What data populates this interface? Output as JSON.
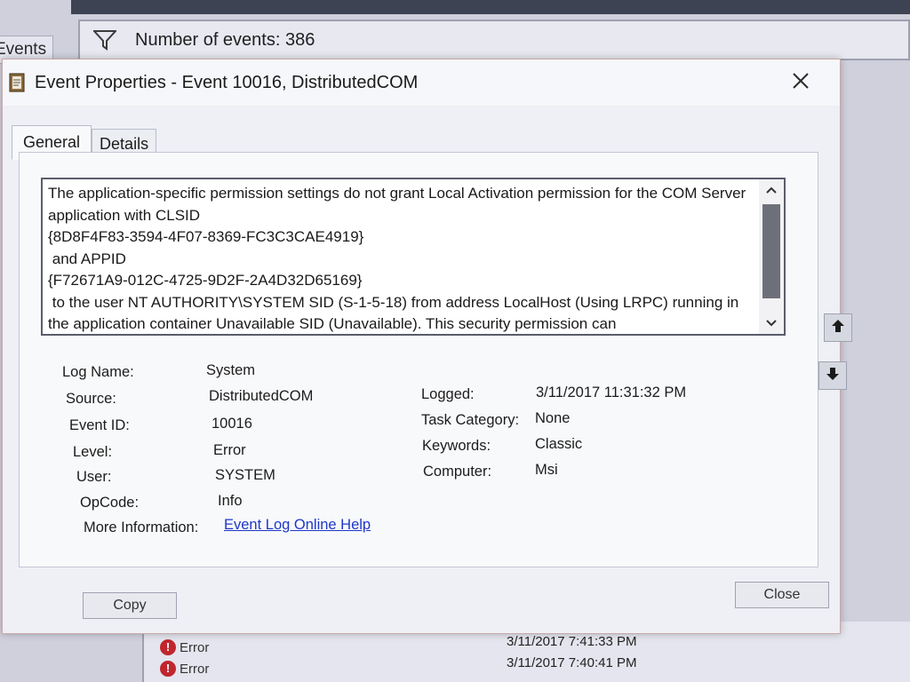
{
  "background": {
    "tab_label": "Events",
    "filter_text": "Number of events: 386",
    "rows": [
      {
        "level": "Error",
        "time": "3/11/2017 7:41:33 PM"
      },
      {
        "level": "Error",
        "time": "3/11/2017 7:40:41 PM"
      }
    ]
  },
  "dialog": {
    "title": "Event Properties - Event 10016, DistributedCOM",
    "tabs": [
      "General",
      "Details"
    ],
    "description": "The application-specific permission settings do not grant Local Activation permission for the COM Server application with CLSID\n{8D8F4F83-3594-4F07-8369-FC3C3CAE4919}\n and APPID\n{F72671A9-012C-4725-9D2F-2A4D32D65169}\n to the user NT AUTHORITY\\SYSTEM SID (S-1-5-18) from address LocalHost (Using LRPC) running in the application container Unavailable SID (Unavailable). This security permission can",
    "fields_left": [
      {
        "label": "Log Name:",
        "value": "System"
      },
      {
        "label": "Source:",
        "value": "DistributedCOM"
      },
      {
        "label": "Event ID:",
        "value": "10016"
      },
      {
        "label": "Level:",
        "value": "Error"
      },
      {
        "label": "User:",
        "value": "SYSTEM"
      },
      {
        "label": "OpCode:",
        "value": "Info"
      }
    ],
    "fields_right": [
      {
        "label": "Logged:",
        "value": "3/11/2017 11:31:32 PM"
      },
      {
        "label": "Task Category:",
        "value": "None"
      },
      {
        "label": "Keywords:",
        "value": "Classic"
      },
      {
        "label": "Computer:",
        "value": "Msi"
      }
    ],
    "more_info_label": "More Information:",
    "more_info_link": "Event Log Online Help",
    "copy_label": "Copy",
    "close_label": "Close"
  },
  "colors": {
    "link": "#1f37c7",
    "error": "#c0262d"
  }
}
